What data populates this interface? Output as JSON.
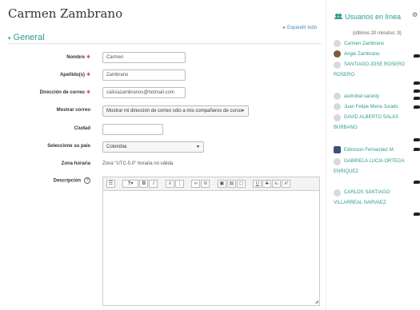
{
  "page": {
    "title": "Carmen Zambrano"
  },
  "section": {
    "expand_all": "Expandir todo",
    "title": "General"
  },
  "form": {
    "nombre": {
      "label": "Nombre",
      "value": "Carmen"
    },
    "apellido": {
      "label": "Apellido(s)",
      "value": "Zambrano"
    },
    "correo": {
      "label": "Dirección de correo",
      "value": "caliciazambranos@hotmail.com"
    },
    "mostrar_correo": {
      "label": "Mostrar correo",
      "value": "Mostrar mi dirección de correo sólo a mis compañeros de curso"
    },
    "ciudad": {
      "label": "Ciudad",
      "value": ""
    },
    "pais": {
      "label": "Seleccione su país",
      "value": "Colombia"
    },
    "zona": {
      "label": "Zona horaria",
      "value": "Zona \"UTC-5.0\" horaria no válida"
    },
    "descripcion": {
      "label": "Descripción"
    }
  },
  "sidebar": {
    "title": "Usuarios en línea",
    "subtitle": "(últimos 20 minutos: 9)",
    "users": [
      "Carmen Zambrano",
      "Angie Zambrano",
      "SANTIAGO JOSE ROSERO ROSERO",
      "asdrubal sarasty",
      "Juan Felipe Mena Jurado",
      "DAVID ALBERTO SALAS BURBANO",
      "Edinsson Fernandez M.",
      "GABRIELA LUCIA ORTEGA ENRIQUEZ",
      "CARLOS SANTIAGO VILLARREAL NARVAEZ"
    ]
  },
  "colors": {
    "accent": "#2d9c8e",
    "link": "#3a8bbb",
    "required": "#d9534f"
  }
}
